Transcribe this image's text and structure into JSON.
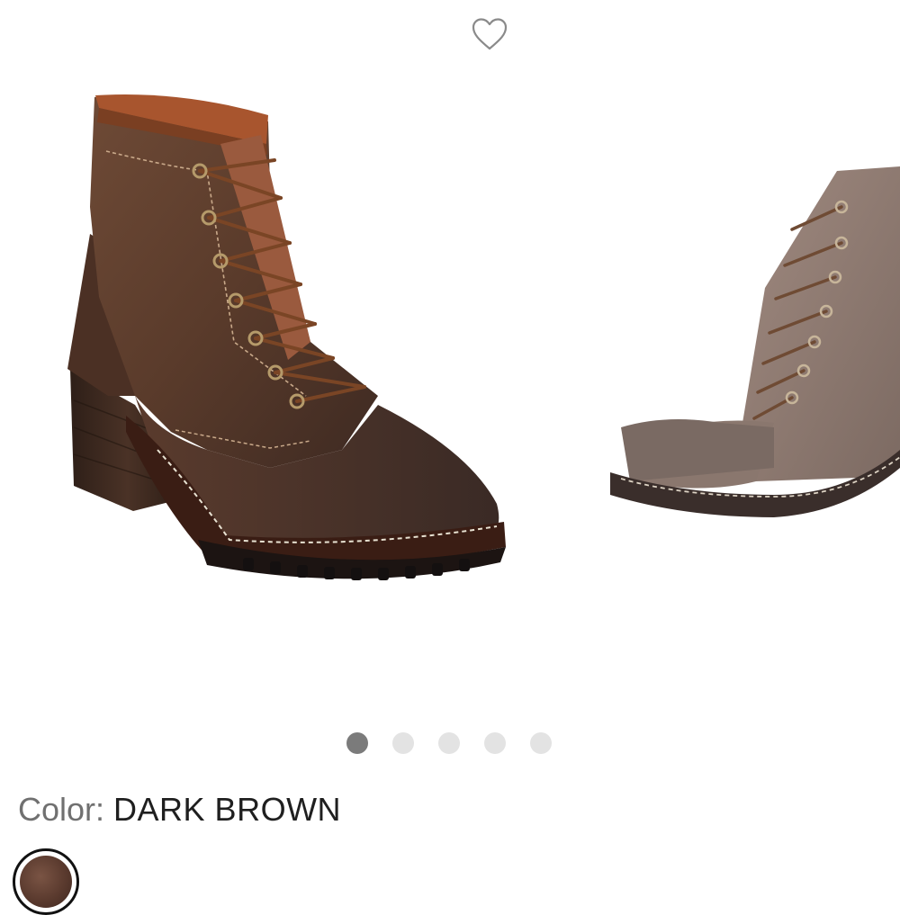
{
  "header": {
    "favorite_icon": "heart-outline-icon"
  },
  "gallery": {
    "image_count": 5,
    "active_index": 0,
    "images": [
      {
        "name": "dark-brown-boot-side-view"
      },
      {
        "name": "boot-partial-next-image"
      }
    ]
  },
  "color": {
    "label": "Color: ",
    "value": "DARK BROWN",
    "swatch_color": "#5a3a2e"
  },
  "colors": {
    "active_dot": "#7b7b7b",
    "inactive_dot": "#e3e3e3"
  }
}
